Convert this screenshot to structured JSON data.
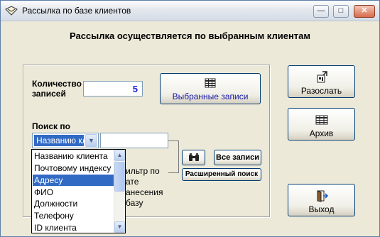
{
  "window": {
    "title": "Рассылка по базе клиентов",
    "minimize_icon": "minimize-icon",
    "maximize_icon": "maximize-icon",
    "close_icon": "close-icon"
  },
  "header": "Рассылка осуществляется по выбранным клиентам",
  "count": {
    "label": "Количество записей",
    "value": "5"
  },
  "selected_button": {
    "label": "Выбранные записи",
    "icon": "table-icon"
  },
  "search": {
    "label": "Поиск по",
    "selected_value": "Названию кл",
    "input_value": "",
    "options": [
      "Названию клиента",
      "Почтовому индексу",
      "Адресу",
      "ФИО",
      "Должности",
      "Телефону",
      "ID клиента"
    ],
    "highlighted_index": 2
  },
  "buttons": {
    "find_icon": "binoculars-icon",
    "all_records": "Все записи",
    "advanced_search": "Расширенный поиск"
  },
  "filter_text": [
    "ильтр по",
    "ате",
    "анесения",
    "базу"
  ],
  "right_buttons": {
    "send": "Разослать",
    "archive": "Архив",
    "exit": "Выход"
  },
  "colors": {
    "accent": "#316ac5",
    "count_value": "#1a1ad6",
    "selected_caption": "#1a1aa8"
  }
}
